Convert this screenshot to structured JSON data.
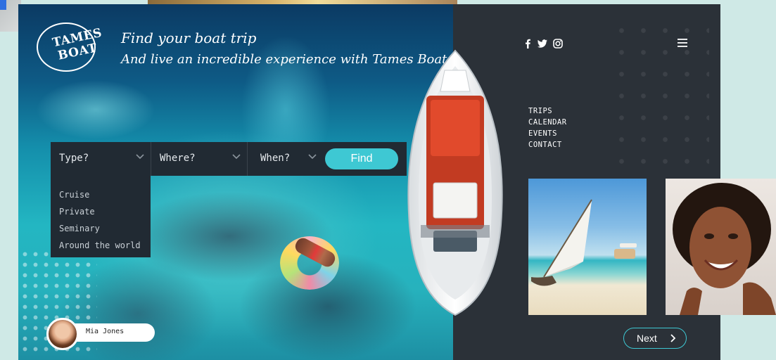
{
  "brand": {
    "logo_line1": "TAMES",
    "logo_line2": "BOAT"
  },
  "hero": {
    "tagline_line1": "Find your boat trip",
    "tagline_line2": "And live an incredible experience with Tames Boat."
  },
  "search": {
    "type_label": "Type?",
    "where_label": "Where?",
    "when_label": "When?",
    "find_label": "Find",
    "type_options": [
      "Cruise",
      "Private",
      "Seminary",
      "Around the world"
    ]
  },
  "profile": {
    "name": "Mia Jones"
  },
  "social": {
    "icons": [
      "facebook-icon",
      "twitter-icon",
      "instagram-icon"
    ]
  },
  "nav": {
    "items": [
      "TRIPS",
      "CALENDAR",
      "EVENTS",
      "CONTACT"
    ]
  },
  "next_label": "Next",
  "colors": {
    "accent": "#3ec8d3",
    "panel": "#2b3138",
    "searchbar": "#212a33",
    "page_background": "#cfe9e6"
  }
}
